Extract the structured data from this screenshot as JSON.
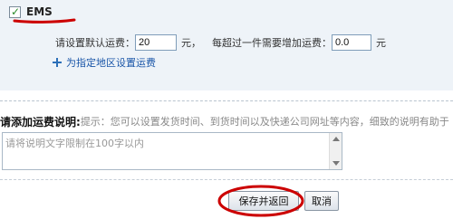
{
  "shipping": {
    "ems_label": "EMS",
    "ems_checked": true,
    "default_fee_label": "请设置默认运费：",
    "default_fee_value": "20",
    "unit1": "元，",
    "extra_fee_label": "每超过一件需要增加运费：",
    "extra_fee_value": "0.0",
    "unit2": "元",
    "region_link": "为指定地区设置运费"
  },
  "description": {
    "label": "请添加运费说明:",
    "hint": "提示：您可以设置发货时间、到货时间以及快递公司网址等内容，细致的说明有助于",
    "placeholder": "请将说明文字限制在100字以内"
  },
  "buttons": {
    "save": "保存并返回",
    "cancel": "取消"
  },
  "colors": {
    "accent_red": "#cc0000",
    "link_blue": "#1a56a8",
    "panel_bg": "#eef3f8"
  }
}
